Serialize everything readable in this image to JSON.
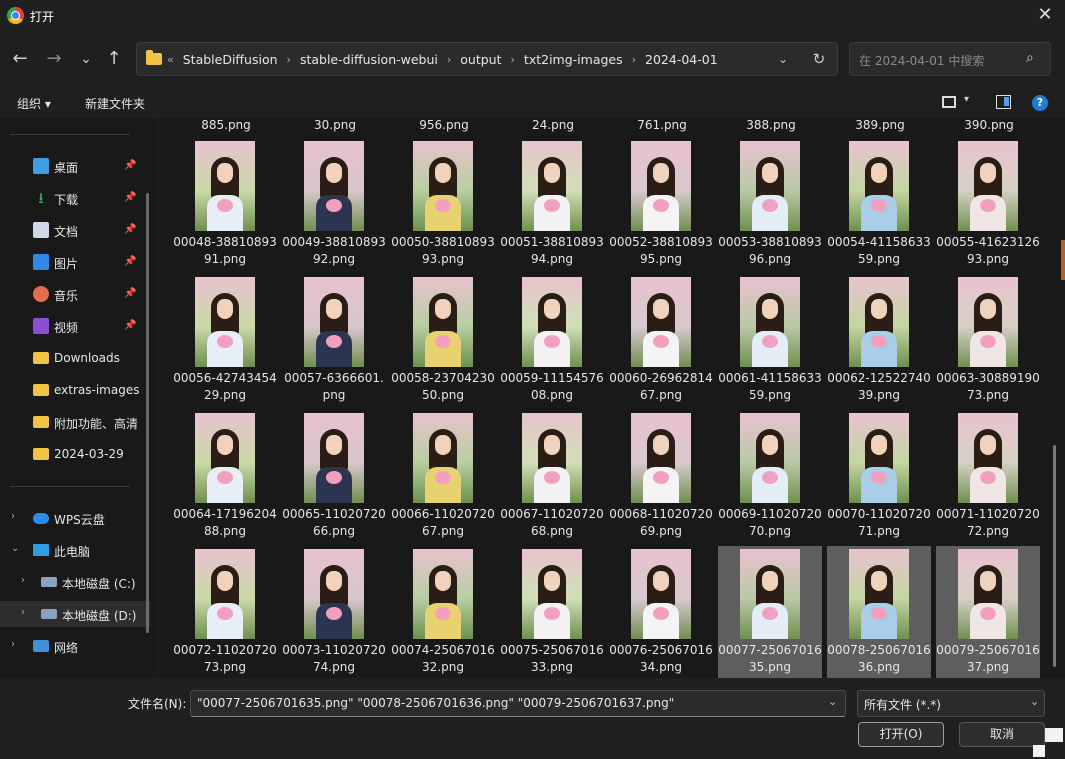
{
  "window": {
    "title": "打开",
    "close": "✕"
  },
  "nav": {
    "back": "←",
    "forward": "→",
    "recent": "⌄",
    "up": "↑",
    "breadcrumb": [
      "StableDiffusion",
      "stable-diffusion-webui",
      "output",
      "txt2img-images",
      "2024-04-01"
    ],
    "overflow": "«",
    "separator": "›",
    "dropdown": "⌄",
    "refresh": "↻",
    "search_placeholder": "在 2024-04-01 中搜索",
    "search_icon": "⌕"
  },
  "toolbar": {
    "organize": "组织 ▾",
    "new_folder": "新建文件夹",
    "view_dd": "▾",
    "help": "?"
  },
  "sidebar": {
    "pin": "📌",
    "items": [
      {
        "label": "桌面",
        "icon": "desktop-icon",
        "pinned": true
      },
      {
        "label": "下载",
        "icon": "download-icon",
        "pinned": true,
        "glyph": "⭳"
      },
      {
        "label": "文档",
        "icon": "document-icon",
        "pinned": true
      },
      {
        "label": "图片",
        "icon": "pictures-icon",
        "pinned": true
      },
      {
        "label": "音乐",
        "icon": "music-icon",
        "pinned": true
      },
      {
        "label": "视频",
        "icon": "video-icon",
        "pinned": true
      },
      {
        "label": "Downloads",
        "icon": "folder-icon",
        "pinned": false
      },
      {
        "label": "extras-images",
        "icon": "folder-icon",
        "pinned": false
      },
      {
        "label": "附加功能、高清",
        "icon": "folder-icon",
        "pinned": false
      },
      {
        "label": "2024-03-29",
        "icon": "folder-icon",
        "pinned": false
      }
    ],
    "tree": [
      {
        "label": "WPS云盘",
        "icon": "cloud-icon",
        "chev": "›"
      },
      {
        "label": "此电脑",
        "icon": "pc-icon",
        "chev": "⌄"
      },
      {
        "label": "本地磁盘 (C:)",
        "icon": "drive-icon",
        "chev": "›"
      },
      {
        "label": "本地磁盘 (D:)",
        "icon": "drive-icon",
        "chev": "›"
      },
      {
        "label": "网络",
        "icon": "network-icon",
        "chev": "›"
      }
    ]
  },
  "top_row": [
    "885.png",
    "30.png",
    "956.png",
    "24.png",
    "761.png",
    "388.png",
    "389.png",
    "390.png"
  ],
  "files": [
    [
      "00048-3881089391.png",
      "00049-3881089392.png",
      "00050-3881089393.png",
      "00051-3881089394.png",
      "00052-3881089395.png",
      "00053-3881089396.png",
      "00054-4115863359.png",
      "00055-4162312693.png"
    ],
    [
      "00056-4274345429.png",
      "00057-6366601.png",
      "00058-2370423050.png",
      "00059-1115457608.png",
      "00060-2696281467.png",
      "00061-4115863359.png",
      "00062-1252274039.png",
      "00063-3088919073.png"
    ],
    [
      "00064-1719620488.png",
      "00065-1102072066.png",
      "00066-1102072067.png",
      "00067-1102072068.png",
      "00068-1102072069.png",
      "00069-1102072070.png",
      "00070-1102072071.png",
      "00071-1102072072.png"
    ],
    [
      "00072-1102072073.png",
      "00073-1102072074.png",
      "00074-2506701632.png",
      "00075-2506701633.png",
      "00076-2506701634.png",
      "00077-2506701635.png",
      "00078-2506701636.png",
      "00079-2506701637.png"
    ]
  ],
  "selected": [
    "00077-2506701635.png",
    "00078-2506701636.png",
    "00079-2506701637.png"
  ],
  "footer": {
    "filename_label": "文件名(N):",
    "filename_value": "\"00077-2506701635.png\" \"00078-2506701636.png\" \"00079-2506701637.png\"",
    "filetype": "所有文件 (*.*)",
    "dropdown": "⌄",
    "open": "打开(O)",
    "cancel": "取消"
  }
}
